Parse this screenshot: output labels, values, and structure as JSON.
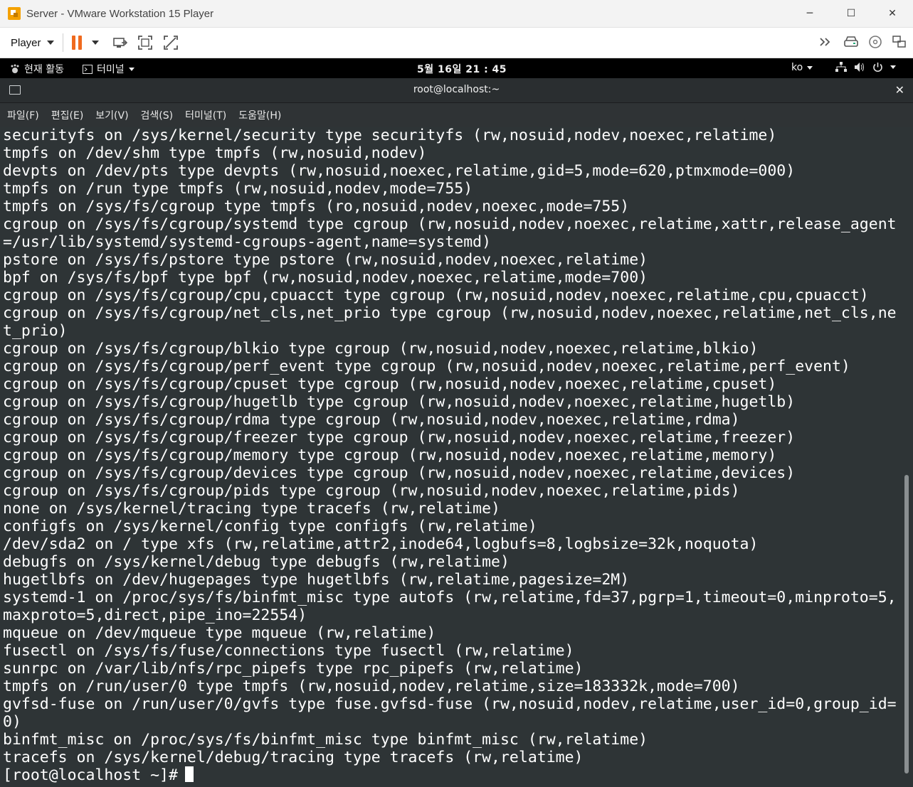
{
  "window": {
    "title": "Server - VMware Workstation 15 Player",
    "controls": [
      "─",
      "☐",
      "✕"
    ]
  },
  "toolbar": {
    "player_label": "Player",
    "right_icons": [
      "forward-icon",
      "removable-device-icon",
      "cd-icon",
      "unity-icon"
    ]
  },
  "gnome": {
    "activities": "현재 활동",
    "app_menu": "터미널",
    "clock": "5월 16일  21 : 45",
    "lang": "ko"
  },
  "terminal": {
    "title": "root@localhost:~",
    "menu": [
      "파일(F)",
      "편집(E)",
      "보기(V)",
      "검색(S)",
      "터미널(T)",
      "도움말(H)"
    ],
    "lines": [
      "securityfs on /sys/kernel/security type securityfs (rw,nosuid,nodev,noexec,relatime)",
      "tmpfs on /dev/shm type tmpfs (rw,nosuid,nodev)",
      "devpts on /dev/pts type devpts (rw,nosuid,noexec,relatime,gid=5,mode=620,ptmxmode=000)",
      "tmpfs on /run type tmpfs (rw,nosuid,nodev,mode=755)",
      "tmpfs on /sys/fs/cgroup type tmpfs (ro,nosuid,nodev,noexec,mode=755)",
      "cgroup on /sys/fs/cgroup/systemd type cgroup (rw,nosuid,nodev,noexec,relatime,xattr,release_agent",
      "=/usr/lib/systemd/systemd-cgroups-agent,name=systemd)",
      "pstore on /sys/fs/pstore type pstore (rw,nosuid,nodev,noexec,relatime)",
      "bpf on /sys/fs/bpf type bpf (rw,nosuid,nodev,noexec,relatime,mode=700)",
      "cgroup on /sys/fs/cgroup/cpu,cpuacct type cgroup (rw,nosuid,nodev,noexec,relatime,cpu,cpuacct)",
      "cgroup on /sys/fs/cgroup/net_cls,net_prio type cgroup (rw,nosuid,nodev,noexec,relatime,net_cls,ne",
      "t_prio)",
      "cgroup on /sys/fs/cgroup/blkio type cgroup (rw,nosuid,nodev,noexec,relatime,blkio)",
      "cgroup on /sys/fs/cgroup/perf_event type cgroup (rw,nosuid,nodev,noexec,relatime,perf_event)",
      "cgroup on /sys/fs/cgroup/cpuset type cgroup (rw,nosuid,nodev,noexec,relatime,cpuset)",
      "cgroup on /sys/fs/cgroup/hugetlb type cgroup (rw,nosuid,nodev,noexec,relatime,hugetlb)",
      "cgroup on /sys/fs/cgroup/rdma type cgroup (rw,nosuid,nodev,noexec,relatime,rdma)",
      "cgroup on /sys/fs/cgroup/freezer type cgroup (rw,nosuid,nodev,noexec,relatime,freezer)",
      "cgroup on /sys/fs/cgroup/memory type cgroup (rw,nosuid,nodev,noexec,relatime,memory)",
      "cgroup on /sys/fs/cgroup/devices type cgroup (rw,nosuid,nodev,noexec,relatime,devices)",
      "cgroup on /sys/fs/cgroup/pids type cgroup (rw,nosuid,nodev,noexec,relatime,pids)",
      "none on /sys/kernel/tracing type tracefs (rw,relatime)",
      "configfs on /sys/kernel/config type configfs (rw,relatime)",
      "/dev/sda2 on / type xfs (rw,relatime,attr2,inode64,logbufs=8,logbsize=32k,noquota)",
      "debugfs on /sys/kernel/debug type debugfs (rw,relatime)",
      "hugetlbfs on /dev/hugepages type hugetlbfs (rw,relatime,pagesize=2M)",
      "systemd-1 on /proc/sys/fs/binfmt_misc type autofs (rw,relatime,fd=37,pgrp=1,timeout=0,minproto=5,",
      "maxproto=5,direct,pipe_ino=22554)",
      "mqueue on /dev/mqueue type mqueue (rw,relatime)",
      "fusectl on /sys/fs/fuse/connections type fusectl (rw,relatime)",
      "sunrpc on /var/lib/nfs/rpc_pipefs type rpc_pipefs (rw,relatime)",
      "tmpfs on /run/user/0 type tmpfs (rw,nosuid,nodev,relatime,size=183332k,mode=700)",
      "gvfsd-fuse on /run/user/0/gvfs type fuse.gvfsd-fuse (rw,nosuid,nodev,relatime,user_id=0,group_id=",
      "0)",
      "binfmt_misc on /proc/sys/fs/binfmt_misc type binfmt_misc (rw,relatime)",
      "tracefs on /sys/kernel/debug/tracing type tracefs (rw,relatime)"
    ],
    "prompt": "[root@localhost ~]#"
  }
}
